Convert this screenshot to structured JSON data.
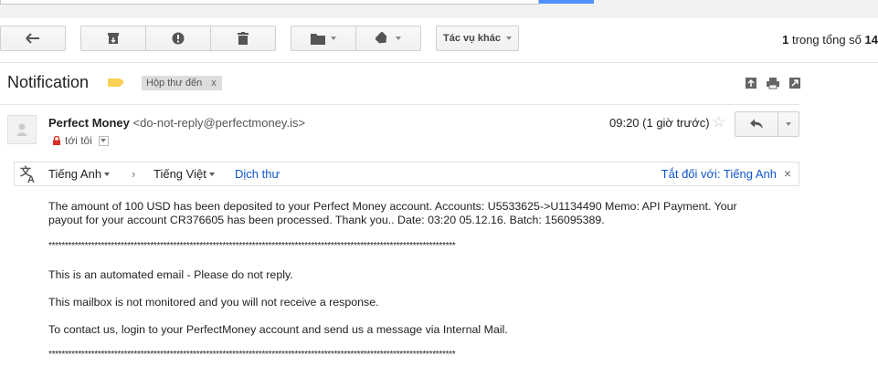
{
  "toolbar": {
    "more_actions_label": "Tác vụ khác",
    "pager": {
      "current": "1",
      "text": " trong tổng số ",
      "total": "14"
    }
  },
  "subject": {
    "title": "Notification",
    "label_chip": "Hộp thư đến",
    "label_chip_close": "x",
    "label_color": "#f8d254"
  },
  "message": {
    "sender_name": "Perfect Money",
    "sender_email": "<do-not-reply@perfectmoney.is>",
    "to_text": "tới tôi",
    "time": "09:20 (1 giờ trước)",
    "star": "☆"
  },
  "translate_bar": {
    "source_lang": "Tiếng Anh",
    "arrow": "›",
    "target_lang": "Tiếng Việt",
    "translate_link": "Dịch thư",
    "turn_off": "Tắt đối với: Tiếng Anh",
    "close": "×"
  },
  "body": {
    "para1_line1": "The amount of 100 USD has been deposited to your Perfect Money account. Accounts: U5533625->U1134490    Memo: API Payment. Your",
    "para1_line2": "payout for your account CR376605 has been processed. Thank you.. Date: 03:20 05.12.16. Batch: 156095389.",
    "separator": "****************************************************************************************************************************",
    "line_automated": "This is an automated email - Please do not reply.",
    "line_mailbox": "This mailbox is not monitored and you will not receive a response.",
    "line_contact": "To contact us, login to your PerfectMoney account and send us a message via Internal Mail.",
    "separator2": "****************************************************************************************************************************"
  },
  "colors": {
    "link": "#1155cc",
    "accent_blue": "#4d90fe",
    "lock_red": "#d93025"
  }
}
